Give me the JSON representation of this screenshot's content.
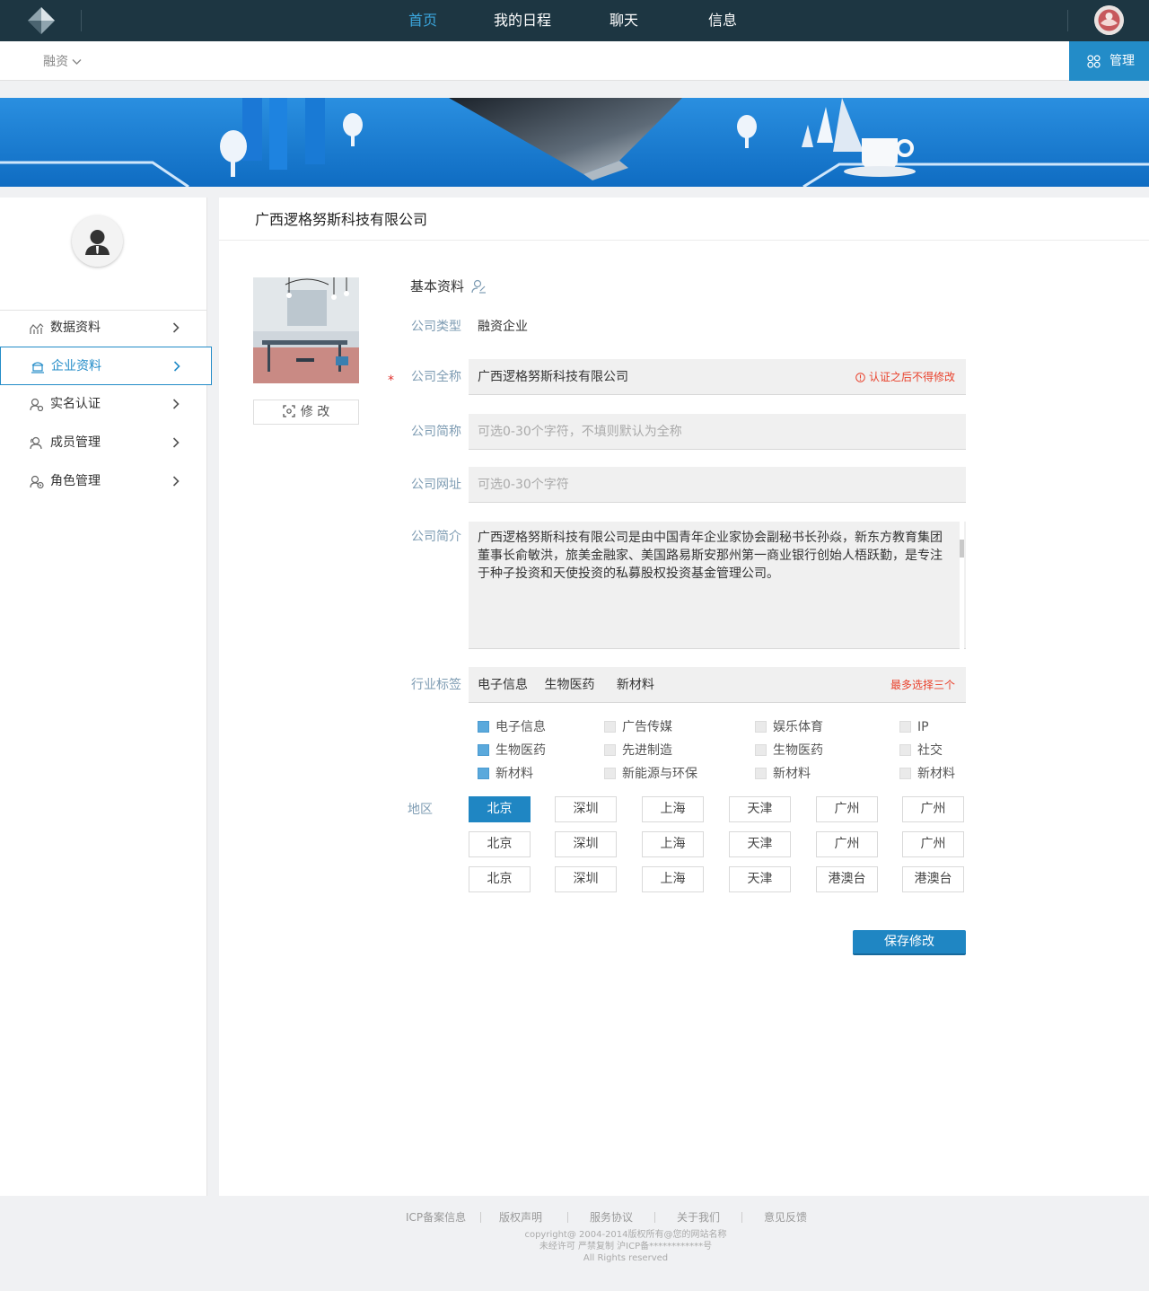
{
  "nav": {
    "items": [
      {
        "label": "首页",
        "active": true
      },
      {
        "label": "我的日程",
        "active": false
      },
      {
        "label": "聊天",
        "active": false
      },
      {
        "label": "信息",
        "active": false
      }
    ]
  },
  "subbar": {
    "dropdown_label": "融资",
    "manage_label": "管理"
  },
  "sidebar": {
    "items": [
      {
        "label": "数据资料",
        "icon": "chart-icon",
        "active": false
      },
      {
        "label": "企业资料",
        "icon": "building-icon",
        "active": true
      },
      {
        "label": "实名认证",
        "icon": "user-verify-icon",
        "active": false
      },
      {
        "label": "成员管理",
        "icon": "members-icon",
        "active": false
      },
      {
        "label": "角色管理",
        "icon": "roles-icon",
        "active": false
      }
    ]
  },
  "main": {
    "title": "广西逻格努斯科技有限公司",
    "edit_photo_label": "修 改",
    "section_title": "基本资料",
    "fields": {
      "type": {
        "label": "公司类型",
        "value": "融资企业"
      },
      "full_name": {
        "label": "公司全称",
        "value": "广西逻格努斯科技有限公司",
        "note": "认证之后不得修改"
      },
      "short_name": {
        "label": "公司简称",
        "placeholder": "可选0-30个字符，不填则默认为全称"
      },
      "website": {
        "label": "公司网址",
        "placeholder": "可选0-30个字符"
      },
      "intro": {
        "label": "公司简介",
        "value": "广西逻格努斯科技有限公司是由中国青年企业家协会副秘书长孙焱，新东方教育集团董事长俞敏洪，旅美金融家、美国路易斯安那州第一商业银行创始人梧跃勤，是专注于种子投资和天使投资的私募股权投资基金管理公司。"
      },
      "industry": {
        "label": "行业标签",
        "selected": [
          "电子信息",
          "生物医药",
          "新材料"
        ],
        "note": "最多选择三个"
      }
    },
    "industry_options": [
      {
        "label": "电子信息",
        "checked": true
      },
      {
        "label": "广告传媒",
        "checked": false
      },
      {
        "label": "娱乐体育",
        "checked": false
      },
      {
        "label": "IP",
        "checked": false
      },
      {
        "label": "生物医药",
        "checked": true
      },
      {
        "label": "先进制造",
        "checked": false
      },
      {
        "label": "生物医药",
        "checked": false
      },
      {
        "label": "社交",
        "checked": false
      },
      {
        "label": "新材料",
        "checked": true
      },
      {
        "label": "新能源与环保",
        "checked": false
      },
      {
        "label": "新材料",
        "checked": false
      },
      {
        "label": "新材料",
        "checked": false
      }
    ],
    "region_label": "地区",
    "regions": [
      {
        "label": "北京",
        "selected": true
      },
      {
        "label": "深圳",
        "selected": false
      },
      {
        "label": "上海",
        "selected": false
      },
      {
        "label": "天津",
        "selected": false
      },
      {
        "label": "广州",
        "selected": false
      },
      {
        "label": "广州",
        "selected": false
      },
      {
        "label": "北京",
        "selected": false
      },
      {
        "label": "深圳",
        "selected": false
      },
      {
        "label": "上海",
        "selected": false
      },
      {
        "label": "天津",
        "selected": false
      },
      {
        "label": "广州",
        "selected": false
      },
      {
        "label": "广州",
        "selected": false
      },
      {
        "label": "北京",
        "selected": false
      },
      {
        "label": "深圳",
        "selected": false
      },
      {
        "label": "上海",
        "selected": false
      },
      {
        "label": "天津",
        "selected": false
      },
      {
        "label": "港澳台",
        "selected": false
      },
      {
        "label": "港澳台",
        "selected": false
      }
    ],
    "save_label": "保存修改"
  },
  "footer": {
    "links": [
      "ICP备案信息",
      "版权声明",
      "服务协议",
      "关于我们",
      "意见反馈"
    ],
    "copyright": "copyright@ 2004-2014版权所有@您的网站名称",
    "notice": "未经许可 严禁复制 沪ICP备************号",
    "rights": "All Rights reserved"
  },
  "colors": {
    "topbar": "#1d3642",
    "accent": "#238cc8",
    "nav_active": "#3ba6dd",
    "warning": "#e9412c",
    "label": "#7e9cb3"
  }
}
